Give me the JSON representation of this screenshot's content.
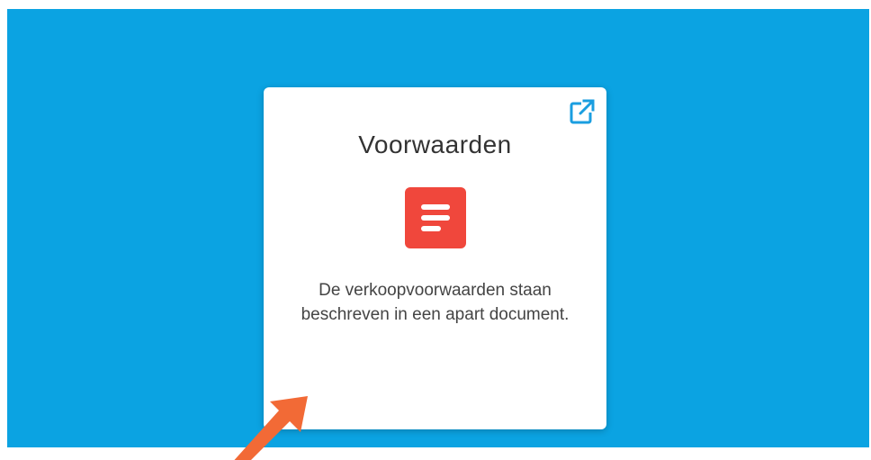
{
  "card": {
    "title": "Voorwaarden",
    "description": "De verkoopvoorwaarden staan beschreven in een apart document.",
    "external_link_icon": "external-link-icon",
    "document_icon": "document-lines-icon"
  },
  "colors": {
    "background_panel": "#0ba3e2",
    "card": "#ffffff",
    "document_icon": "#f0473c",
    "external_link_icon": "#1a9ee0",
    "annotation_arrow": "#f26a36"
  },
  "annotation": {
    "icon": "arrow-icon"
  }
}
